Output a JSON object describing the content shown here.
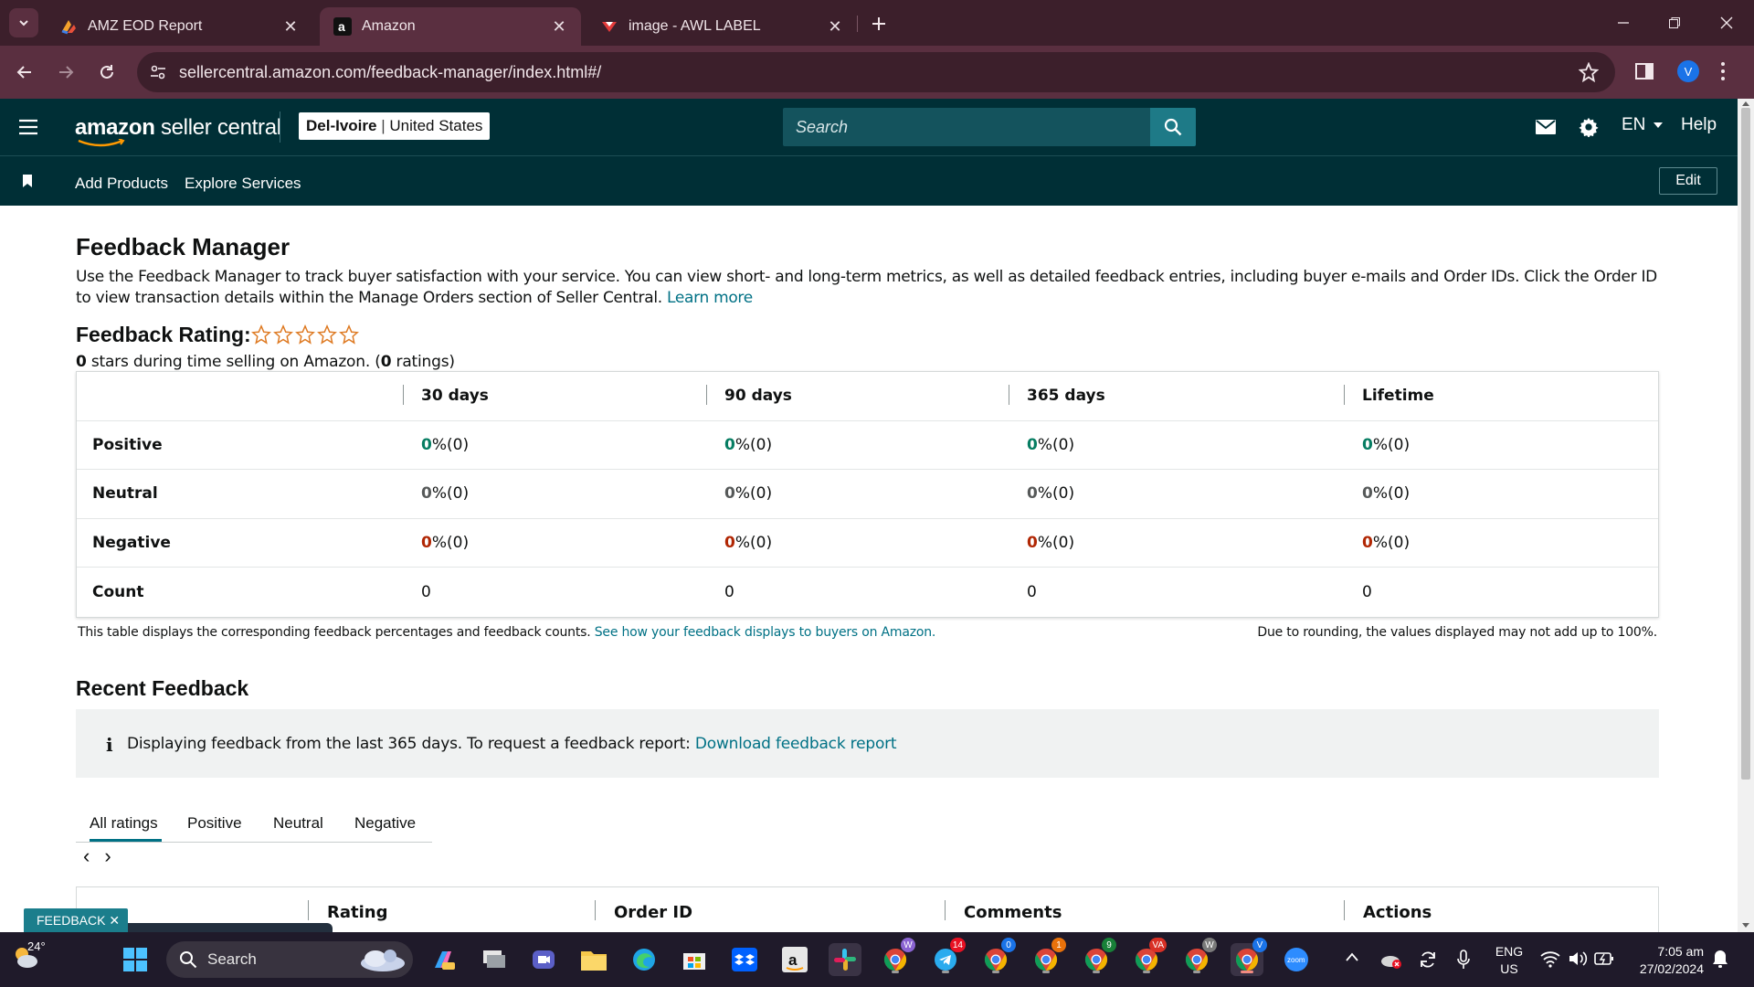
{
  "browser": {
    "tabs": [
      {
        "title": "AMZ EOD Report",
        "close": "✕"
      },
      {
        "title": "Amazon",
        "close": "✕"
      },
      {
        "title": "image - AWL LABEL",
        "close": "✕"
      }
    ],
    "url": "sellercentral.amazon.com/feedback-manager/index.html#/",
    "profile_initial": "V"
  },
  "header": {
    "logo_brand": "amazon",
    "logo_suffix": "seller central",
    "store_name": "Del-Ivoire",
    "store_region": "United States",
    "search_placeholder": "Search",
    "language": "EN",
    "help": "Help",
    "nav_links": [
      "Add Products",
      "Explore Services"
    ],
    "edit": "Edit"
  },
  "page": {
    "title": "Feedback Manager",
    "intro": "Use the Feedback Manager to track buyer satisfaction with your service. You can view short- and long-term metrics, as well as detailed feedback entries, including buyer e-mails and Order IDs. Click the Order ID to view transaction details within the Manage Orders section of Seller Central.",
    "learn_more": "Learn more",
    "rating_title": "Feedback Rating:",
    "stars_filled": 0,
    "stars_total": 5,
    "rating_stars_count": "0",
    "rating_sub_mid": " stars during time selling on Amazon. (",
    "rating_count": "0",
    "rating_sub_end": " ratings)"
  },
  "feedback_table": {
    "columns": [
      "30 days",
      "90 days",
      "365 days",
      "Lifetime"
    ],
    "rows": [
      {
        "label": "Positive",
        "cells": [
          {
            "num": "0",
            "suffix": " %(0)"
          },
          {
            "num": "0",
            "suffix": " %(0)"
          },
          {
            "num": "0",
            "suffix": " %(0)"
          },
          {
            "num": "0",
            "suffix": " %(0)"
          }
        ]
      },
      {
        "label": "Neutral",
        "cells": [
          {
            "num": "0",
            "suffix": " %(0)"
          },
          {
            "num": "0",
            "suffix": " %(0)"
          },
          {
            "num": "0",
            "suffix": " %(0)"
          },
          {
            "num": "0",
            "suffix": " %(0)"
          }
        ]
      },
      {
        "label": "Negative",
        "cells": [
          {
            "num": "0",
            "suffix": " %(0)"
          },
          {
            "num": "0",
            "suffix": " %(0)"
          },
          {
            "num": "0",
            "suffix": " %(0)"
          },
          {
            "num": "0",
            "suffix": " %(0)"
          }
        ]
      },
      {
        "label": "Count",
        "cells": [
          {
            "num": "0",
            "suffix": ""
          },
          {
            "num": "0",
            "suffix": ""
          },
          {
            "num": "0",
            "suffix": ""
          },
          {
            "num": "0",
            "suffix": ""
          }
        ]
      }
    ],
    "footnote": "This table displays the corresponding feedback percentages and feedback counts. ",
    "footnote_link": "See how your feedback displays to buyers on Amazon.",
    "footnote_right": "Due to rounding, the values displayed may not add up to 100%."
  },
  "recent": {
    "title": "Recent Feedback",
    "info_icon": "i",
    "info_text": "Displaying feedback from the last 365 days. To request a feedback report: ",
    "info_link": "Download feedback report",
    "tabs": [
      "All ratings",
      "Positive",
      "Neutral",
      "Negative"
    ],
    "active_tab": "All ratings",
    "pager_prev": "‹",
    "pager_next": "›",
    "table_headers": [
      "Rating",
      "Order ID",
      "Comments",
      "Actions"
    ],
    "feedback_badge": "FEEDBACK ✕"
  },
  "taskbar": {
    "weather": "24°",
    "search": "Search",
    "lang_top": "ENG",
    "lang_bottom": "US",
    "time": "7:05 am",
    "date": "27/02/2024",
    "badges": {
      "w1": "W",
      "telegram": "14",
      "b2": "0",
      "b3": "1",
      "b4": "9",
      "va": "VA",
      "w2": "W",
      "v": "V"
    }
  },
  "colors": {
    "header_bg": "#002f36",
    "tab_bg": "#3c1f2b",
    "link": "#007185",
    "positive": "#067d62",
    "negative": "#b12704"
  }
}
